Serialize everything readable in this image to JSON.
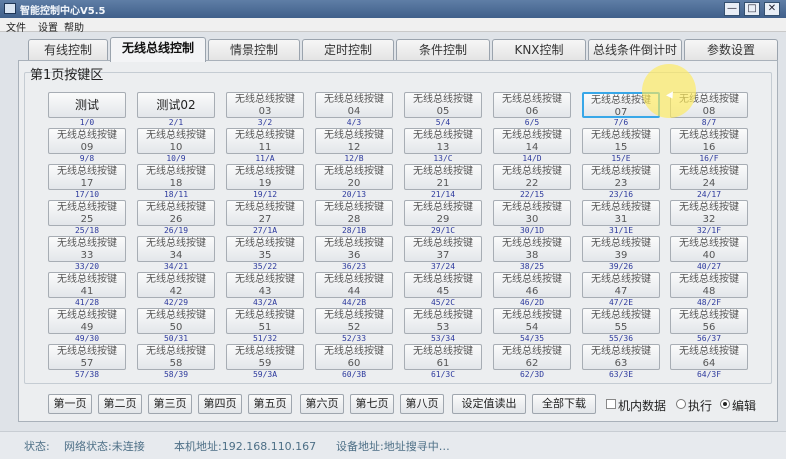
{
  "window": {
    "title": "智能控制中心V5.5",
    "minimize": "—",
    "maximize": "□",
    "close": "✕",
    "app_icon": "app-icon"
  },
  "menu": [
    "文件",
    "设置",
    "帮助"
  ],
  "tabs": [
    "有线控制",
    "无线总线控制",
    "情景控制",
    "定时控制",
    "条件控制",
    "KNX控制",
    "总线条件倒计时",
    "参数设置"
  ],
  "active_tab": "无线总线控制",
  "group_title": "第1页按键区",
  "keys": [
    {
      "line1": "测试",
      "line2": "",
      "addr": "1/0"
    },
    {
      "line1": "测试02",
      "line2": "",
      "addr": "2/1"
    },
    {
      "line1": "无线总线按键",
      "line2": "03",
      "addr": "3/2"
    },
    {
      "line1": "无线总线按键",
      "line2": "04",
      "addr": "4/3"
    },
    {
      "line1": "无线总线按键",
      "line2": "05",
      "addr": "5/4"
    },
    {
      "line1": "无线总线按键",
      "line2": "06",
      "addr": "6/5"
    },
    {
      "line1": "无线总线按键",
      "line2": "07",
      "addr": "7/6"
    },
    {
      "line1": "无线总线按键",
      "line2": "08",
      "addr": "8/7"
    },
    {
      "line1": "无线总线按键",
      "line2": "09",
      "addr": "9/8"
    },
    {
      "line1": "无线总线按键",
      "line2": "10",
      "addr": "10/9"
    },
    {
      "line1": "无线总线按键",
      "line2": "11",
      "addr": "11/A"
    },
    {
      "line1": "无线总线按键",
      "line2": "12",
      "addr": "12/B"
    },
    {
      "line1": "无线总线按键",
      "line2": "13",
      "addr": "13/C"
    },
    {
      "line1": "无线总线按键",
      "line2": "14",
      "addr": "14/D"
    },
    {
      "line1": "无线总线按键",
      "line2": "15",
      "addr": "15/E"
    },
    {
      "line1": "无线总线按键",
      "line2": "16",
      "addr": "16/F"
    },
    {
      "line1": "无线总线按键",
      "line2": "17",
      "addr": "17/10"
    },
    {
      "line1": "无线总线按键",
      "line2": "18",
      "addr": "18/11"
    },
    {
      "line1": "无线总线按键",
      "line2": "19",
      "addr": "19/12"
    },
    {
      "line1": "无线总线按键",
      "line2": "20",
      "addr": "20/13"
    },
    {
      "line1": "无线总线按键",
      "line2": "21",
      "addr": "21/14"
    },
    {
      "line1": "无线总线按键",
      "line2": "22",
      "addr": "22/15"
    },
    {
      "line1": "无线总线按键",
      "line2": "23",
      "addr": "23/16"
    },
    {
      "line1": "无线总线按键",
      "line2": "24",
      "addr": "24/17"
    },
    {
      "line1": "无线总线按键",
      "line2": "25",
      "addr": "25/18"
    },
    {
      "line1": "无线总线按键",
      "line2": "26",
      "addr": "26/19"
    },
    {
      "line1": "无线总线按键",
      "line2": "27",
      "addr": "27/1A"
    },
    {
      "line1": "无线总线按键",
      "line2": "28",
      "addr": "28/1B"
    },
    {
      "line1": "无线总线按键",
      "line2": "29",
      "addr": "29/1C"
    },
    {
      "line1": "无线总线按键",
      "line2": "30",
      "addr": "30/1D"
    },
    {
      "line1": "无线总线按键",
      "line2": "31",
      "addr": "31/1E"
    },
    {
      "line1": "无线总线按键",
      "line2": "32",
      "addr": "32/1F"
    },
    {
      "line1": "无线总线按键",
      "line2": "33",
      "addr": "33/20"
    },
    {
      "line1": "无线总线按键",
      "line2": "34",
      "addr": "34/21"
    },
    {
      "line1": "无线总线按键",
      "line2": "35",
      "addr": "35/22"
    },
    {
      "line1": "无线总线按键",
      "line2": "36",
      "addr": "36/23"
    },
    {
      "line1": "无线总线按键",
      "line2": "37",
      "addr": "37/24"
    },
    {
      "line1": "无线总线按键",
      "line2": "38",
      "addr": "38/25"
    },
    {
      "line1": "无线总线按键",
      "line2": "39",
      "addr": "39/26"
    },
    {
      "line1": "无线总线按键",
      "line2": "40",
      "addr": "40/27"
    },
    {
      "line1": "无线总线按键",
      "line2": "41",
      "addr": "41/28"
    },
    {
      "line1": "无线总线按键",
      "line2": "42",
      "addr": "42/29"
    },
    {
      "line1": "无线总线按键",
      "line2": "43",
      "addr": "43/2A"
    },
    {
      "line1": "无线总线按键",
      "line2": "44",
      "addr": "44/2B"
    },
    {
      "line1": "无线总线按键",
      "line2": "45",
      "addr": "45/2C"
    },
    {
      "line1": "无线总线按键",
      "line2": "46",
      "addr": "46/2D"
    },
    {
      "line1": "无线总线按键",
      "line2": "47",
      "addr": "47/2E"
    },
    {
      "line1": "无线总线按键",
      "line2": "48",
      "addr": "48/2F"
    },
    {
      "line1": "无线总线按键",
      "line2": "49",
      "addr": "49/30"
    },
    {
      "line1": "无线总线按键",
      "line2": "50",
      "addr": "50/31"
    },
    {
      "line1": "无线总线按键",
      "line2": "51",
      "addr": "51/32"
    },
    {
      "line1": "无线总线按键",
      "line2": "52",
      "addr": "52/33"
    },
    {
      "line1": "无线总线按键",
      "line2": "53",
      "addr": "53/34"
    },
    {
      "line1": "无线总线按键",
      "line2": "54",
      "addr": "54/35"
    },
    {
      "line1": "无线总线按键",
      "line2": "55",
      "addr": "55/36"
    },
    {
      "line1": "无线总线按键",
      "line2": "56",
      "addr": "56/37"
    },
    {
      "line1": "无线总线按键",
      "line2": "57",
      "addr": "57/38"
    },
    {
      "line1": "无线总线按键",
      "line2": "58",
      "addr": "58/39"
    },
    {
      "line1": "无线总线按键",
      "line2": "59",
      "addr": "59/3A"
    },
    {
      "line1": "无线总线按键",
      "line2": "60",
      "addr": "60/3B"
    },
    {
      "line1": "无线总线按键",
      "line2": "61",
      "addr": "61/3C"
    },
    {
      "line1": "无线总线按键",
      "line2": "62",
      "addr": "62/3D"
    },
    {
      "line1": "无线总线按键",
      "line2": "63",
      "addr": "63/3E"
    },
    {
      "line1": "无线总线按键",
      "line2": "64",
      "addr": "64/3F"
    }
  ],
  "selected_key": "07",
  "pages": [
    "第一页",
    "第二页",
    "第三页",
    "第四页",
    "第五页",
    "第六页",
    "第七页",
    "第八页"
  ],
  "actions": {
    "read_settings": "设定值读出",
    "download_all": "全部下载"
  },
  "options": {
    "local_data": "机内数据",
    "local_data_checked": false,
    "execute": "执行",
    "edit": "编辑",
    "mode": "编辑"
  },
  "status": {
    "label": "状态:",
    "network": "网络状态:未连接",
    "local_address": "本机地址:192.168.110.167",
    "device_address": "设备地址:地址搜寻中…"
  },
  "colors": {
    "address_text": "#2d3a9d",
    "selected_border": "#38a7e8",
    "status_text": "#4d6f86",
    "titlebar": "#4a6a96"
  }
}
